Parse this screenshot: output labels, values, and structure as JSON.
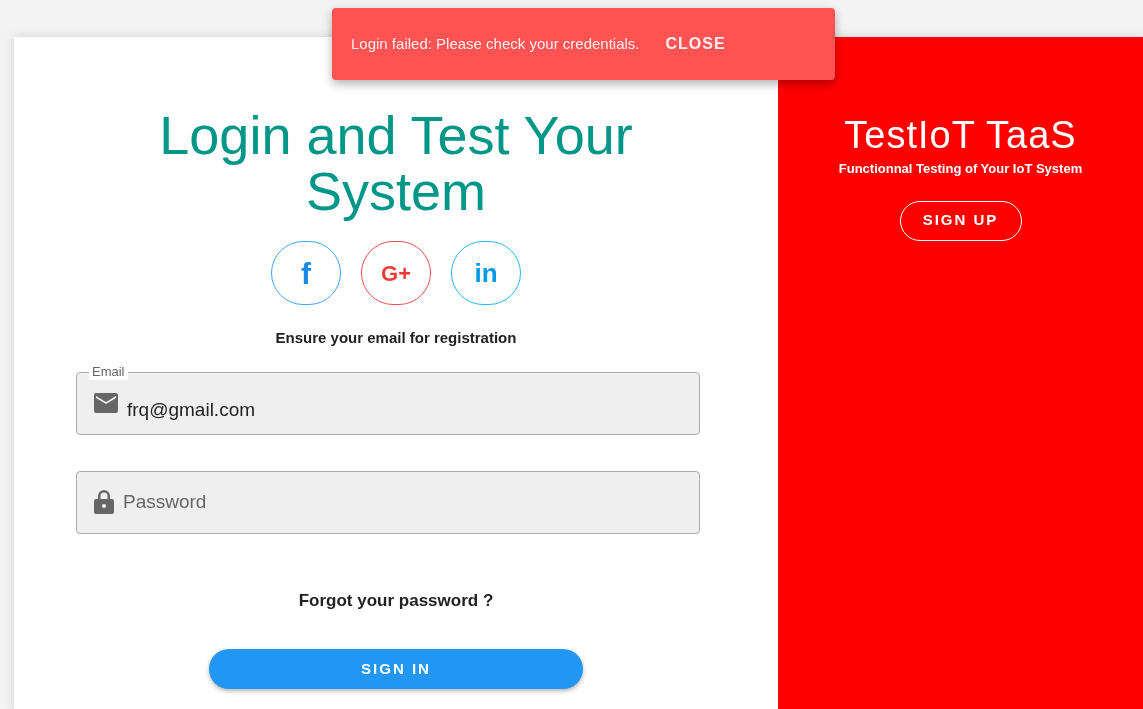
{
  "snackbar": {
    "message": "Login failed: Please check your credentials.",
    "action": "CLOSE"
  },
  "login": {
    "title": "Login and Test Your System",
    "social_buttons": [
      {
        "kind": "facebook",
        "glyph": "f"
      },
      {
        "kind": "google",
        "glyph": "G+"
      },
      {
        "kind": "linkedin",
        "glyph": "in"
      }
    ],
    "hint": "Ensure your email for registration",
    "fields": [
      {
        "kind": "email",
        "label": "Email",
        "value": "frq@gmail.com"
      },
      {
        "kind": "password",
        "placeholder": "Password"
      }
    ],
    "forgot_link": "Forgot your password ?",
    "submit": "SIGN IN"
  },
  "promo": {
    "title": "TestIoT TaaS",
    "subtitle": "Functionnal Testing of Your IoT System",
    "button": "SIGN UP"
  }
}
